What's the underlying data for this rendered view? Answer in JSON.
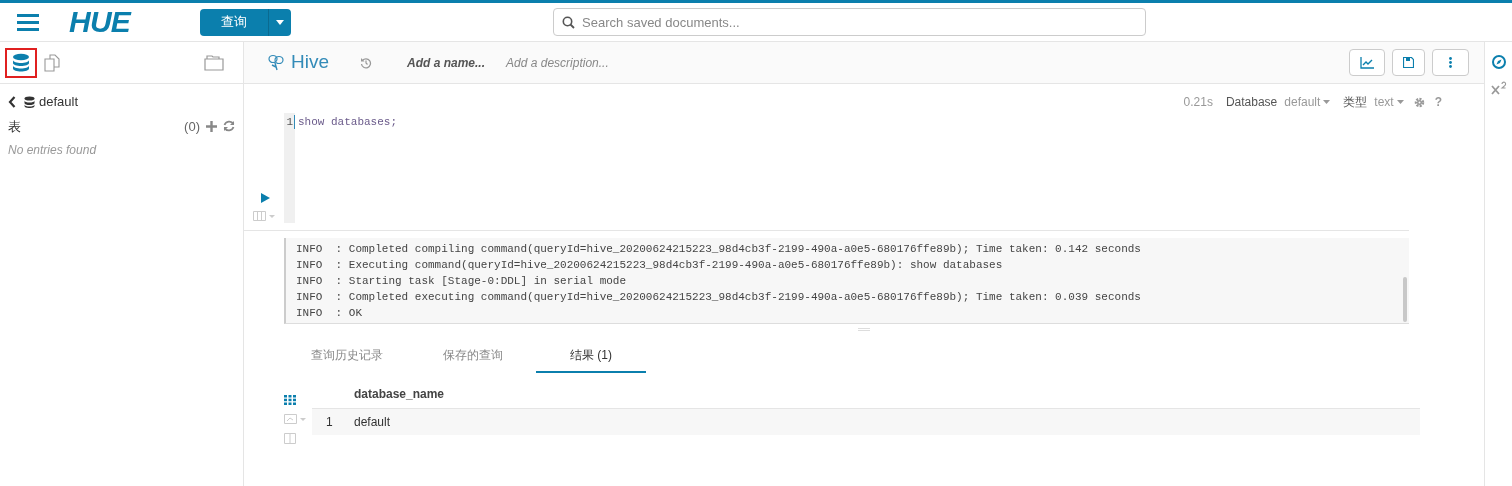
{
  "header": {
    "logo": "HUE",
    "query_button": "查询",
    "search": {
      "placeholder": "Search saved documents..."
    }
  },
  "sidebar": {
    "tabs": [
      {
        "kind": "database",
        "selected": true
      },
      {
        "kind": "documents",
        "selected": false
      }
    ],
    "back_label": "default",
    "section_label": "表",
    "count": "(0)",
    "empty_text": "No entries found"
  },
  "editor": {
    "title": "Hive",
    "name_placeholder": "Add a name...",
    "description_placeholder": "Add a description...",
    "elapsed": "0.21s",
    "database_label": "Database",
    "database_value": "default",
    "type_label": "类型",
    "type_value": "text",
    "help": "?",
    "line_number": "1",
    "code": "show databases;"
  },
  "log_lines": [
    "INFO  : Completed compiling command(queryId=hive_20200624215223_98d4cb3f-2199-490a-a0e5-680176ffe89b); Time taken: 0.142 seconds",
    "INFO  : Executing command(queryId=hive_20200624215223_98d4cb3f-2199-490a-a0e5-680176ffe89b): show databases",
    "INFO  : Starting task [Stage-0:DDL] in serial mode",
    "INFO  : Completed executing command(queryId=hive_20200624215223_98d4cb3f-2199-490a-a0e5-680176ffe89b); Time taken: 0.039 seconds",
    "INFO  : OK"
  ],
  "result_tabs": [
    {
      "label": "查询历史记录",
      "selected": false
    },
    {
      "label": "保存的查询",
      "selected": false
    },
    {
      "label": "结果 (1)",
      "selected": true
    }
  ],
  "result_views": [
    {
      "kind": "grid",
      "selected": true
    },
    {
      "kind": "chart",
      "selected": false
    },
    {
      "kind": "columns",
      "selected": false
    }
  ],
  "table": {
    "columns": [
      "",
      "database_name"
    ],
    "rows": [
      [
        "1",
        "default"
      ]
    ]
  }
}
